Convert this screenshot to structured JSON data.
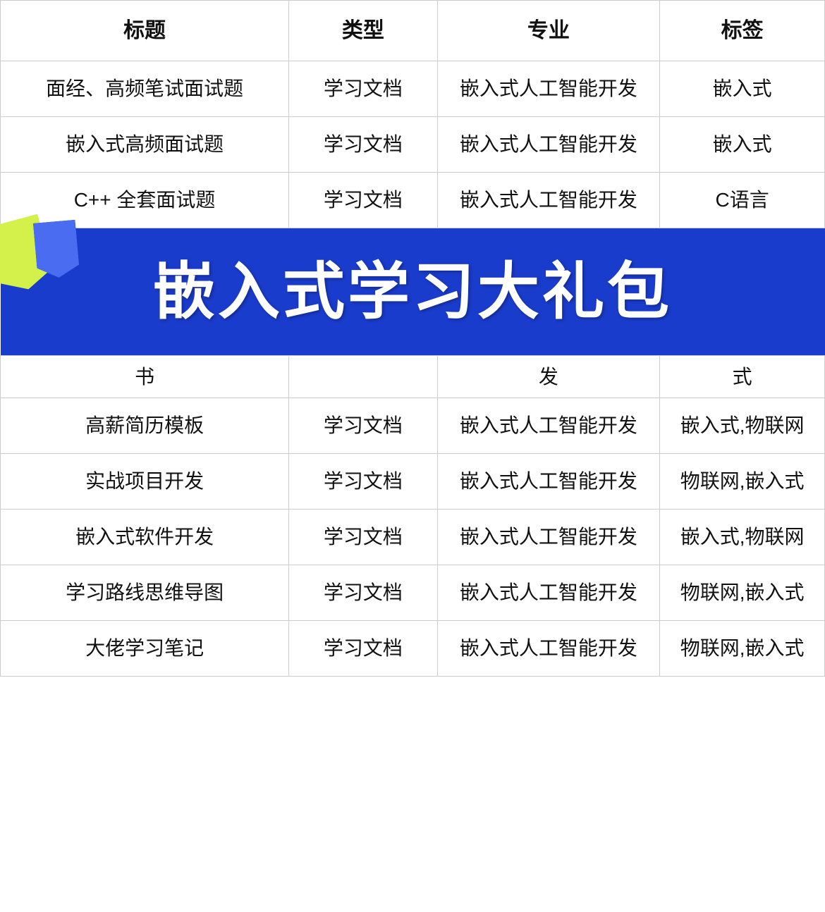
{
  "table": {
    "headers": [
      "标题",
      "类型",
      "专业",
      "标签"
    ],
    "banner_text": "嵌入式学习大礼包",
    "rows": [
      {
        "title": "面经、高频笔试面试题",
        "type": "学习文档",
        "major": "嵌入式人工智能开发",
        "tag": "嵌入式"
      },
      {
        "title": "嵌入式高频面试题",
        "type": "学习文档",
        "major": "嵌入式人工智能开发",
        "tag": "嵌入式"
      },
      {
        "title": "C++ 全套面试题",
        "type": "学习文档",
        "major": "嵌入式人工智能开发",
        "tag": "C语言"
      },
      {
        "title": "书",
        "type": "",
        "major": "发",
        "tag": "式"
      },
      {
        "title": "高薪简历模板",
        "type": "学习文档",
        "major": "嵌入式人工智能开发",
        "tag": "嵌入式,物联网"
      },
      {
        "title": "实战项目开发",
        "type": "学习文档",
        "major": "嵌入式人工智能开发",
        "tag": "物联网,嵌入式"
      },
      {
        "title": "嵌入式软件开发",
        "type": "学习文档",
        "major": "嵌入式人工智能开发",
        "tag": "嵌入式,物联网"
      },
      {
        "title": "学习路线思维导图",
        "type": "学习文档",
        "major": "嵌入式人工智能开发",
        "tag": "物联网,嵌入式"
      },
      {
        "title": "大佬学习笔记",
        "type": "学习文档",
        "major": "嵌入式人工智能开发",
        "tag": "物联网,嵌入式"
      }
    ]
  }
}
